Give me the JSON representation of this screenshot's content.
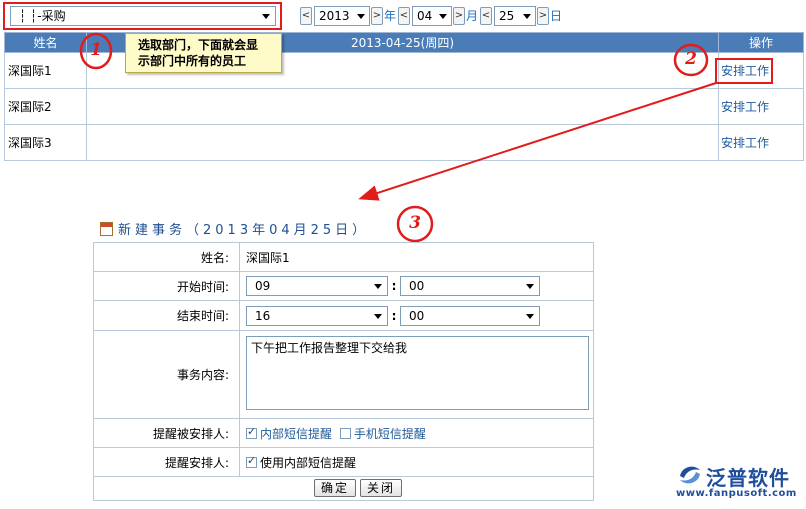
{
  "toolbar": {
    "department": "┆ ┆-采购",
    "year": "2013",
    "year_unit": "年",
    "month": "04",
    "month_unit": "月",
    "day": "25",
    "day_unit": "日",
    "prev_glyph": "<",
    "next_glyph": ">"
  },
  "schedule": {
    "col_name": "姓名",
    "col_date": "2013-04-25(周四)",
    "col_action": "操作",
    "rows": [
      {
        "name": "深国际1",
        "action": "安排工作"
      },
      {
        "name": "深国际2",
        "action": "安排工作"
      },
      {
        "name": "深国际3",
        "action": "安排工作"
      }
    ]
  },
  "annotations": {
    "step1": "1",
    "step2": "2",
    "step3": "3",
    "tip_line1": "选取部门，下面就会显",
    "tip_line2": "示部门中所有的员工",
    "accent_color": "#e21b1b"
  },
  "form": {
    "title": "新建事务（2013年04月25日）",
    "name_label": "姓名:",
    "name_value": "深国际1",
    "start_label": "开始时间:",
    "start_hour": "09",
    "start_min": "00",
    "end_label": "结束时间:",
    "end_hour": "16",
    "end_min": "00",
    "colon": ":",
    "content_label": "事务内容:",
    "content_value": "下午把工作报告整理下交给我",
    "remind_assignee_label": "提醒被安排人:",
    "remind_internal": "内部短信提醒",
    "remind_mobile": "手机短信提醒",
    "remind_assigner_label": "提醒安排人:",
    "remind_use_internal": "使用内部短信提醒",
    "ok_button": "确定",
    "close_button": "关闭"
  },
  "brand": {
    "name": "泛普软件",
    "url": "www.fanpusoft.com",
    "color": "#1f4e9c"
  }
}
